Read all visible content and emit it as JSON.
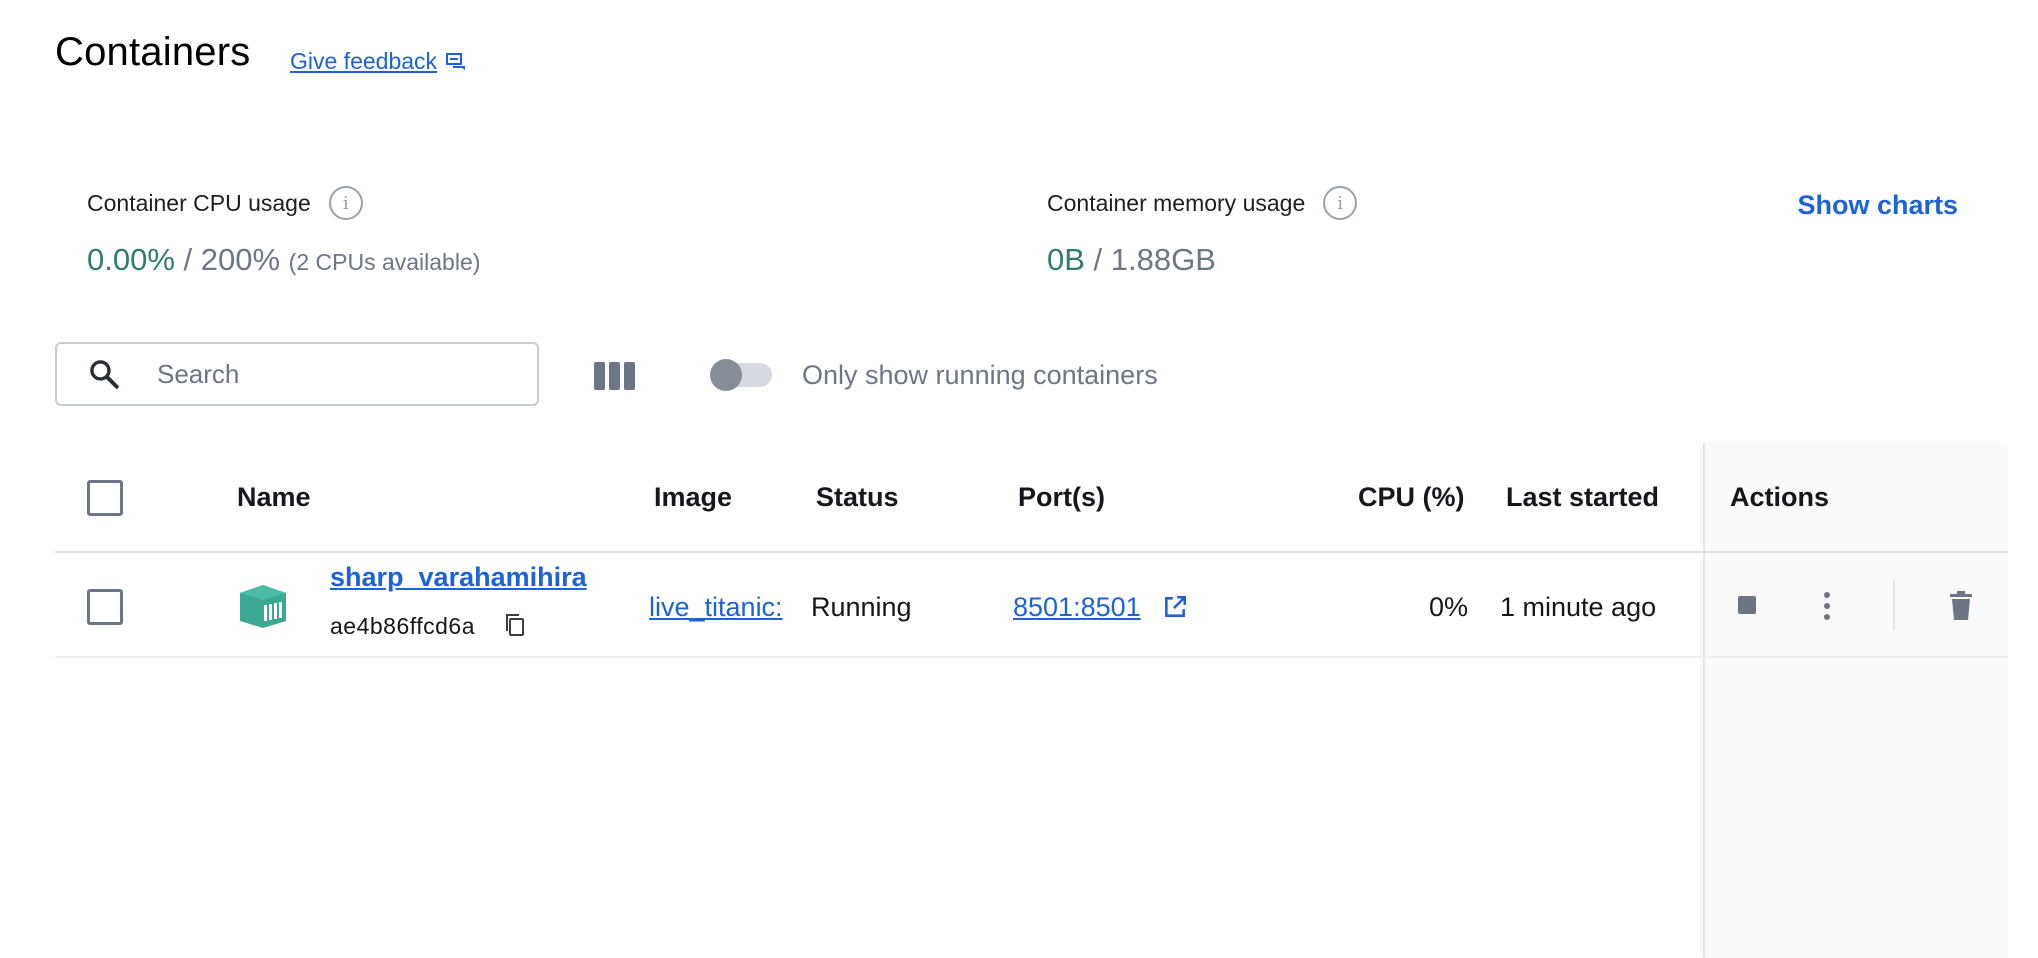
{
  "header": {
    "title": "Containers",
    "feedback_label": "Give feedback"
  },
  "stats": {
    "cpu": {
      "label": "Container CPU usage",
      "used": "0.00%",
      "separator": " / ",
      "total": "200%",
      "note": "(2 CPUs available)"
    },
    "memory": {
      "label": "Container memory usage",
      "used": "0B",
      "separator": " / ",
      "total": "1.88GB"
    },
    "show_charts_label": "Show charts"
  },
  "toolbar": {
    "search_placeholder": "Search",
    "toggle_label": "Only show running containers",
    "toggle_on": false
  },
  "table": {
    "columns": [
      "Name",
      "Image",
      "Status",
      "Port(s)",
      "CPU (%)",
      "Last started",
      "Actions"
    ],
    "rows": [
      {
        "name": "sharp_varahamihira",
        "id": "ae4b86ffcd6a",
        "image": "live_titanic:",
        "status": "Running",
        "ports": "8501:8501",
        "cpu": "0%",
        "last_started": "1 minute ago"
      }
    ]
  },
  "colors": {
    "accent": "#1d63d8",
    "used_value": "#2f7d6d",
    "muted": "#6d7684",
    "container_icon": "#3aa893"
  },
  "icons": {
    "feedback": "feedback-icon",
    "info": "info-icon",
    "search": "search-icon",
    "columns": "columns-icon",
    "container": "container-icon",
    "copy": "copy-icon",
    "external_link": "external-link-icon",
    "stop": "stop-icon",
    "more": "more-vertical-icon",
    "delete": "trash-icon"
  }
}
